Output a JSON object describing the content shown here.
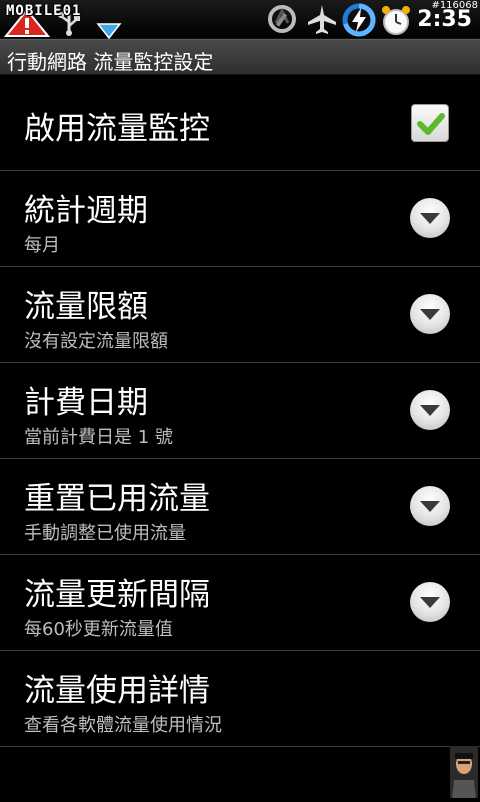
{
  "status_bar": {
    "watermark": "MOBILE01",
    "clock": "2:35",
    "build_tag": "#116068",
    "icons": [
      "warning-icon",
      "usb-icon",
      "download-icon",
      "data-sync-icon",
      "airplane-mode-icon",
      "battery-charging-icon",
      "alarm-clock-icon"
    ]
  },
  "title_bar": {
    "title": "行動網路 流量監控設定"
  },
  "preferences": [
    {
      "title": "啟用流量監控",
      "widget": "checkbox",
      "checked": true
    },
    {
      "title": "統計週期",
      "summary": "每月",
      "widget": "dropdown"
    },
    {
      "title": "流量限額",
      "summary": "沒有設定流量限額",
      "widget": "dropdown"
    },
    {
      "title": "計費日期",
      "summary": "當前計費日是 1 號",
      "widget": "dropdown"
    },
    {
      "title": "重置已用流量",
      "summary": "手動調整已使用流量",
      "widget": "dropdown"
    },
    {
      "title": "流量更新間隔",
      "summary": "每60秒更新流量值",
      "widget": "dropdown"
    },
    {
      "title": "流量使用詳情",
      "summary": "查看各軟體流量使用情況",
      "widget": "none"
    }
  ],
  "colors": {
    "background": "#000000",
    "title_bar": "#3c3c3c",
    "summary_text": "#bdbdbd",
    "check_green": "#5cb82e",
    "divider": "#3a3a3a"
  }
}
